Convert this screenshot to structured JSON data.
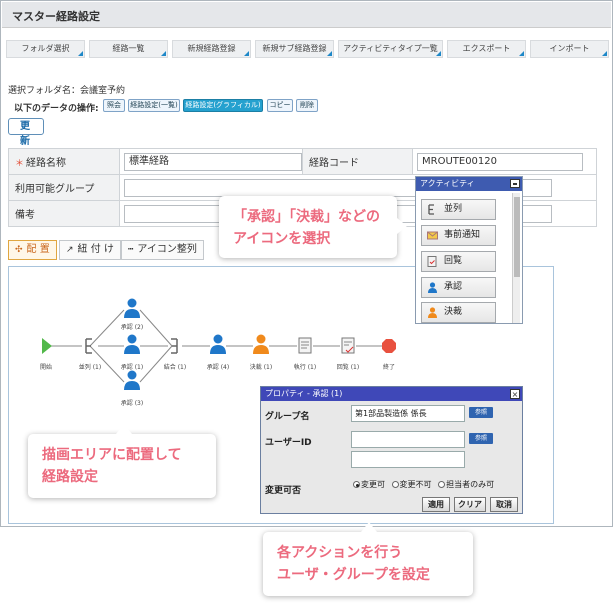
{
  "window": {
    "title": "マスター経路設定"
  },
  "tabs": [
    "フォルダ選択",
    "経路一覧",
    "新規経路登録",
    "新規サブ経路登録",
    "アクティビティタイプ一覧",
    "エクスポート",
    "インポート"
  ],
  "folder": {
    "label": "選択フォルダ名：会議室予約"
  },
  "operations": {
    "label": "以下のデータの操作:",
    "buttons": [
      "照会",
      "経路設定(一覧)",
      "経路設定(グラフィカル)",
      "コピー",
      "削除"
    ],
    "active_index": 2
  },
  "update_button": "更　新",
  "form": {
    "route_name_label": "経路名称",
    "route_name_value": "標準経路",
    "route_code_label": "経路コード",
    "route_code_value": "MROUTE00120",
    "group_label": "利用可能グループ",
    "note_label": "備考"
  },
  "toolbar": {
    "place": "配 置",
    "link": "紐 付 け",
    "align": "アイコン整列"
  },
  "diagram": {
    "nodes": [
      "開始",
      "並列 (1)",
      "承認 (2)",
      "承認 (1)",
      "承認 (3)",
      "結合 (1)",
      "承認 (4)",
      "決裁 (1)",
      "執行 (1)",
      "回覧 (1)",
      "終了"
    ]
  },
  "palette": {
    "title": "アクティビティ",
    "items": [
      "並列",
      "事前通知",
      "回覧",
      "承認",
      "決裁"
    ]
  },
  "properties": {
    "title": "プロパティ - 承認 (1)",
    "group_label": "グループ名",
    "group_value": "第1部品製造係 係長",
    "user_label": "ユーザーID",
    "change_label": "変更可否",
    "ref": "参照",
    "radio_options": [
      "変更可",
      "変更不可",
      "担当者のみ可"
    ],
    "selected_radio": 0,
    "buttons": [
      "適用",
      "クリア",
      "取消"
    ]
  },
  "callouts": {
    "top_line1": "「承認」「決裁」などの",
    "top_line2": "アイコンを選択",
    "left_line1": "描画エリアに配置して",
    "left_line2": "経路設定",
    "bottom_line1": "各アクションを行う",
    "bottom_line2": "ユーザ・グループを設定"
  },
  "colors": {
    "accent_blue": "#1e88c8",
    "active_op": "#25a1cf",
    "callout_text": "#ec6a7e",
    "user_blue": "#1f77c9",
    "user_orange": "#f08a1c",
    "start_green": "#52b84a",
    "end_red": "#e8513f"
  }
}
